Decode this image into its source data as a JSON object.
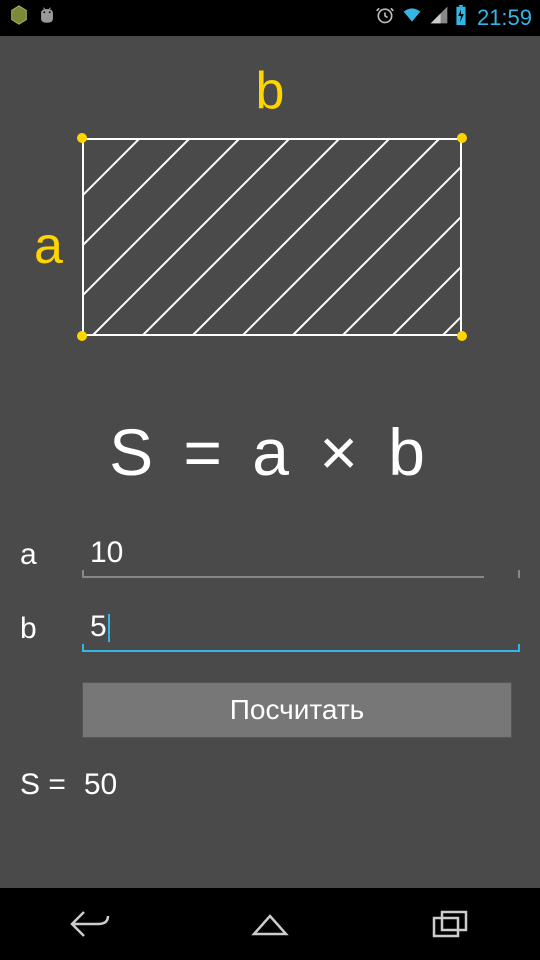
{
  "status": {
    "time": "21:59"
  },
  "diagram": {
    "label_a": "a",
    "label_b": "b"
  },
  "formula": "S = a × b",
  "inputs": {
    "a_label": "a",
    "a_value": "10",
    "b_label": "b",
    "b_value": "5"
  },
  "button": {
    "calculate": "Посчитать"
  },
  "result": {
    "label": "S =",
    "value": "50"
  }
}
